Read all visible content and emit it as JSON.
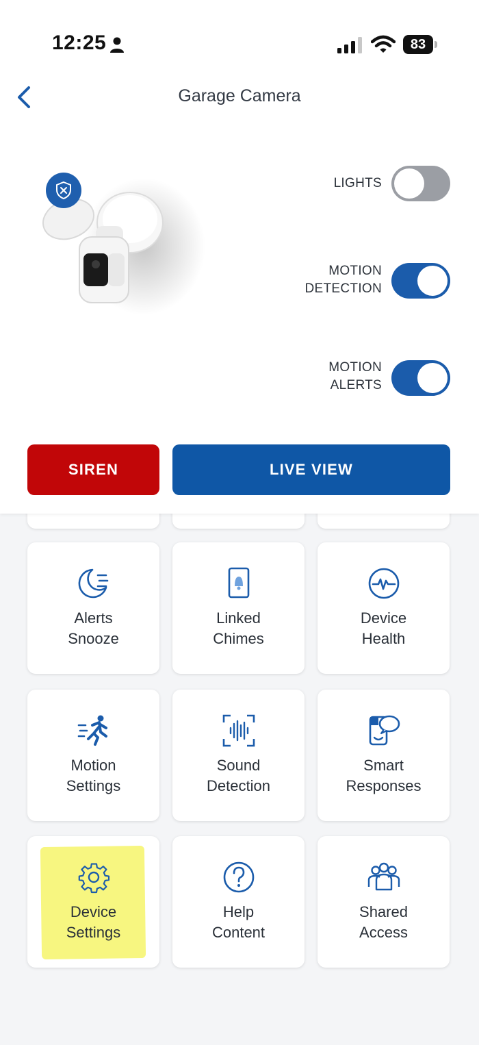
{
  "status_bar": {
    "time": "12:25",
    "battery": "83",
    "icons": [
      "person-icon",
      "cellular-signal-icon",
      "wifi-icon",
      "battery-icon"
    ]
  },
  "header": {
    "title": "Garage Camera",
    "back_icon": "chevron-left-icon"
  },
  "toggles": {
    "lights": {
      "label": "LIGHTS",
      "state": "off"
    },
    "motion_detection": {
      "label": "MOTION\nDETECTION",
      "line1": "MOTION",
      "line2": "DETECTION",
      "state": "on"
    },
    "motion_alerts": {
      "label": "MOTION\nALERTS",
      "line1": "MOTION",
      "line2": "ALERTS",
      "state": "on"
    }
  },
  "actions": {
    "siren": "SIREN",
    "live_view": "LIVE VIEW"
  },
  "colors": {
    "accent": "#1b5cab",
    "siren": "#c10608",
    "live_view": "#0f57a6",
    "highlight": "#f6f56a"
  },
  "tiles": [
    {
      "label": "Alerts\nSnooze",
      "icon": "moon-snooze-icon"
    },
    {
      "label": "Linked\nChimes",
      "icon": "chime-icon"
    },
    {
      "label": "Device\nHealth",
      "icon": "health-pulse-icon"
    },
    {
      "label": "Motion\nSettings",
      "icon": "running-person-icon"
    },
    {
      "label": "Sound\nDetection",
      "icon": "sound-wave-icon"
    },
    {
      "label": "Smart\nResponses",
      "icon": "smart-response-icon"
    },
    {
      "label": "Device\nSettings",
      "icon": "gear-icon",
      "highlighted": true
    },
    {
      "label": "Help\nContent",
      "icon": "question-circle-icon"
    },
    {
      "label": "Shared\nAccess",
      "icon": "people-group-icon"
    }
  ]
}
